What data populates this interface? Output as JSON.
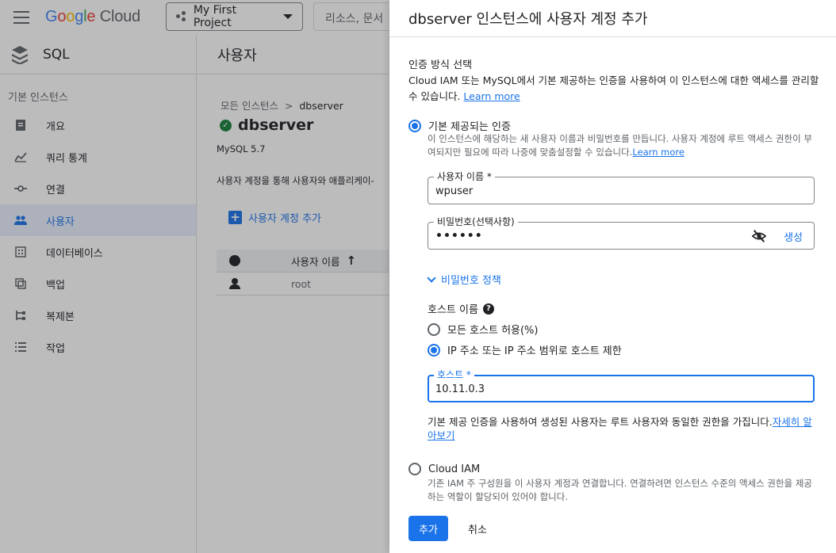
{
  "topbar": {
    "logo": {
      "G": "G",
      "o1": "o",
      "o2": "o",
      "g": "g",
      "l": "l",
      "e": "e",
      "cloud": " Cloud"
    },
    "project": "My First Project",
    "search_placeholder": "리소스, 문서"
  },
  "sidebar": {
    "product": "SQL",
    "section": "기본 인스턴스",
    "items": [
      {
        "label": "개요",
        "icon": "overview-icon"
      },
      {
        "label": "쿼리 통계",
        "icon": "query-insights-icon"
      },
      {
        "label": "연결",
        "icon": "connections-icon"
      },
      {
        "label": "사용자",
        "icon": "users-icon",
        "active": true
      },
      {
        "label": "데이터베이스",
        "icon": "databases-icon"
      },
      {
        "label": "백업",
        "icon": "backups-icon"
      },
      {
        "label": "복제본",
        "icon": "replicas-icon"
      },
      {
        "label": "작업",
        "icon": "operations-icon"
      }
    ]
  },
  "main": {
    "title": "사용자",
    "breadcrumb": {
      "parent": "모든 인스턴스",
      "sep": ">",
      "current": "dbserver"
    },
    "instance": "dbserver",
    "version": "MySQL 5.7",
    "description": "사용자 계정을 통해 사용자와 애플리케이-",
    "add_link": "사용자 계정 추가",
    "table": {
      "header": "사용자 이름",
      "sort_icon": "↑",
      "rows": [
        {
          "name": "root"
        }
      ]
    }
  },
  "panel": {
    "title": "dbserver 인스턴스에 사용자 계정 추가",
    "auth": {
      "title": "인증 방식 선택",
      "description": "Cloud IAM 또는 MySQL에서 기본 제공하는 인증을 사용하여 이 인스턴스에 대한 액세스를 관리할 수 있습니다. ",
      "learn_more": "Learn more"
    },
    "builtin": {
      "label": "기본 제공되는 인증",
      "description": "이 인스턴스에 해당하는 새 사용자 이름과 비밀번호를 만듭니다. 사용자 계정에 루트 액세스 권한이 부여되지만 필요에 따라 나중에 맞춤설정할 수 있습니다.",
      "learn_more": "Learn more",
      "selected": true
    },
    "username": {
      "label": "사용자 이름 *",
      "value": "wpuser"
    },
    "password": {
      "label": "비밀번호(선택사항)",
      "value": "••••••",
      "generate": "생성"
    },
    "password_policy": "비밀번호 정책",
    "host": {
      "title": "호스트 이름",
      "options": [
        {
          "label": "모든 호스트 허용(%)",
          "selected": false
        },
        {
          "label": "IP 주소 또는 IP 주소 범위로 호스트 제한",
          "selected": true
        }
      ],
      "field_label": "호스트 *",
      "field_value": "10.11.0.3"
    },
    "builtin_note": "기본 제공 인증을 사용하여 생성된 사용자는 루트 사용자와 동일한 권한을 가집니다.",
    "builtin_note_link": "자세히 알아보기",
    "cloud_iam": {
      "label": "Cloud IAM",
      "description": "기존 IAM 주 구성원을 이 사용자 계정과 연결합니다. 연결하려면 인스턴스 수준의 액세스 권한을 제공하는 역할이 할당되어 있어야 합니다.",
      "selected": false
    },
    "buttons": {
      "add": "추가",
      "cancel": "취소"
    }
  }
}
